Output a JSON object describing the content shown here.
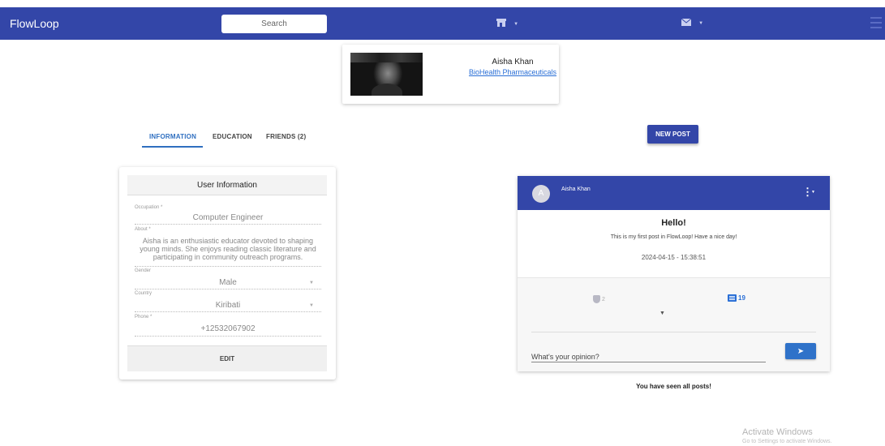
{
  "navbar": {
    "brand": "FlowLoop",
    "search_placeholder": "Search",
    "icons": [
      "store-icon",
      "mail-icon",
      "menu-icon"
    ]
  },
  "profile": {
    "name": "Aisha Khan",
    "company": "BioHealth Pharmaceuticals"
  },
  "tabs": [
    {
      "label": "INFORMATION",
      "active": true
    },
    {
      "label": "EDUCATION",
      "active": false
    },
    {
      "label": "FRIENDS (2)",
      "active": false
    }
  ],
  "new_post_label": "NEW POST",
  "user_info": {
    "title": "User Information",
    "occupation_label": "Occupation *",
    "occupation": "Computer Engineer",
    "about_label": "About *",
    "about": "Aisha is an enthusiastic educator devoted to shaping young minds. She enjoys reading classic literature and participating in community outreach programs.",
    "gender_label": "Gender",
    "gender": "Male",
    "country_label": "Country",
    "country": "Kiribati",
    "phone_label": "Phone *",
    "phone": "+12532067902",
    "edit_label": "EDIT"
  },
  "post": {
    "avatar_letter": "A",
    "author": "Aisha Khan",
    "title": "Hello!",
    "body": "This is my first post in FlowLoop! Have a nice day!",
    "date": "2024-04-15 - 15:38:51",
    "likes": "2",
    "comments": "19",
    "comment_placeholder": "What's your opinion?"
  },
  "seen_all": "You have seen all posts!",
  "watermark": {
    "title": "Activate Windows",
    "subtitle": "Go to Settings to activate Windows."
  },
  "colors": {
    "primary": "#3346a8",
    "link": "#2a6fd6",
    "active_tab": "#2f6fc0"
  }
}
